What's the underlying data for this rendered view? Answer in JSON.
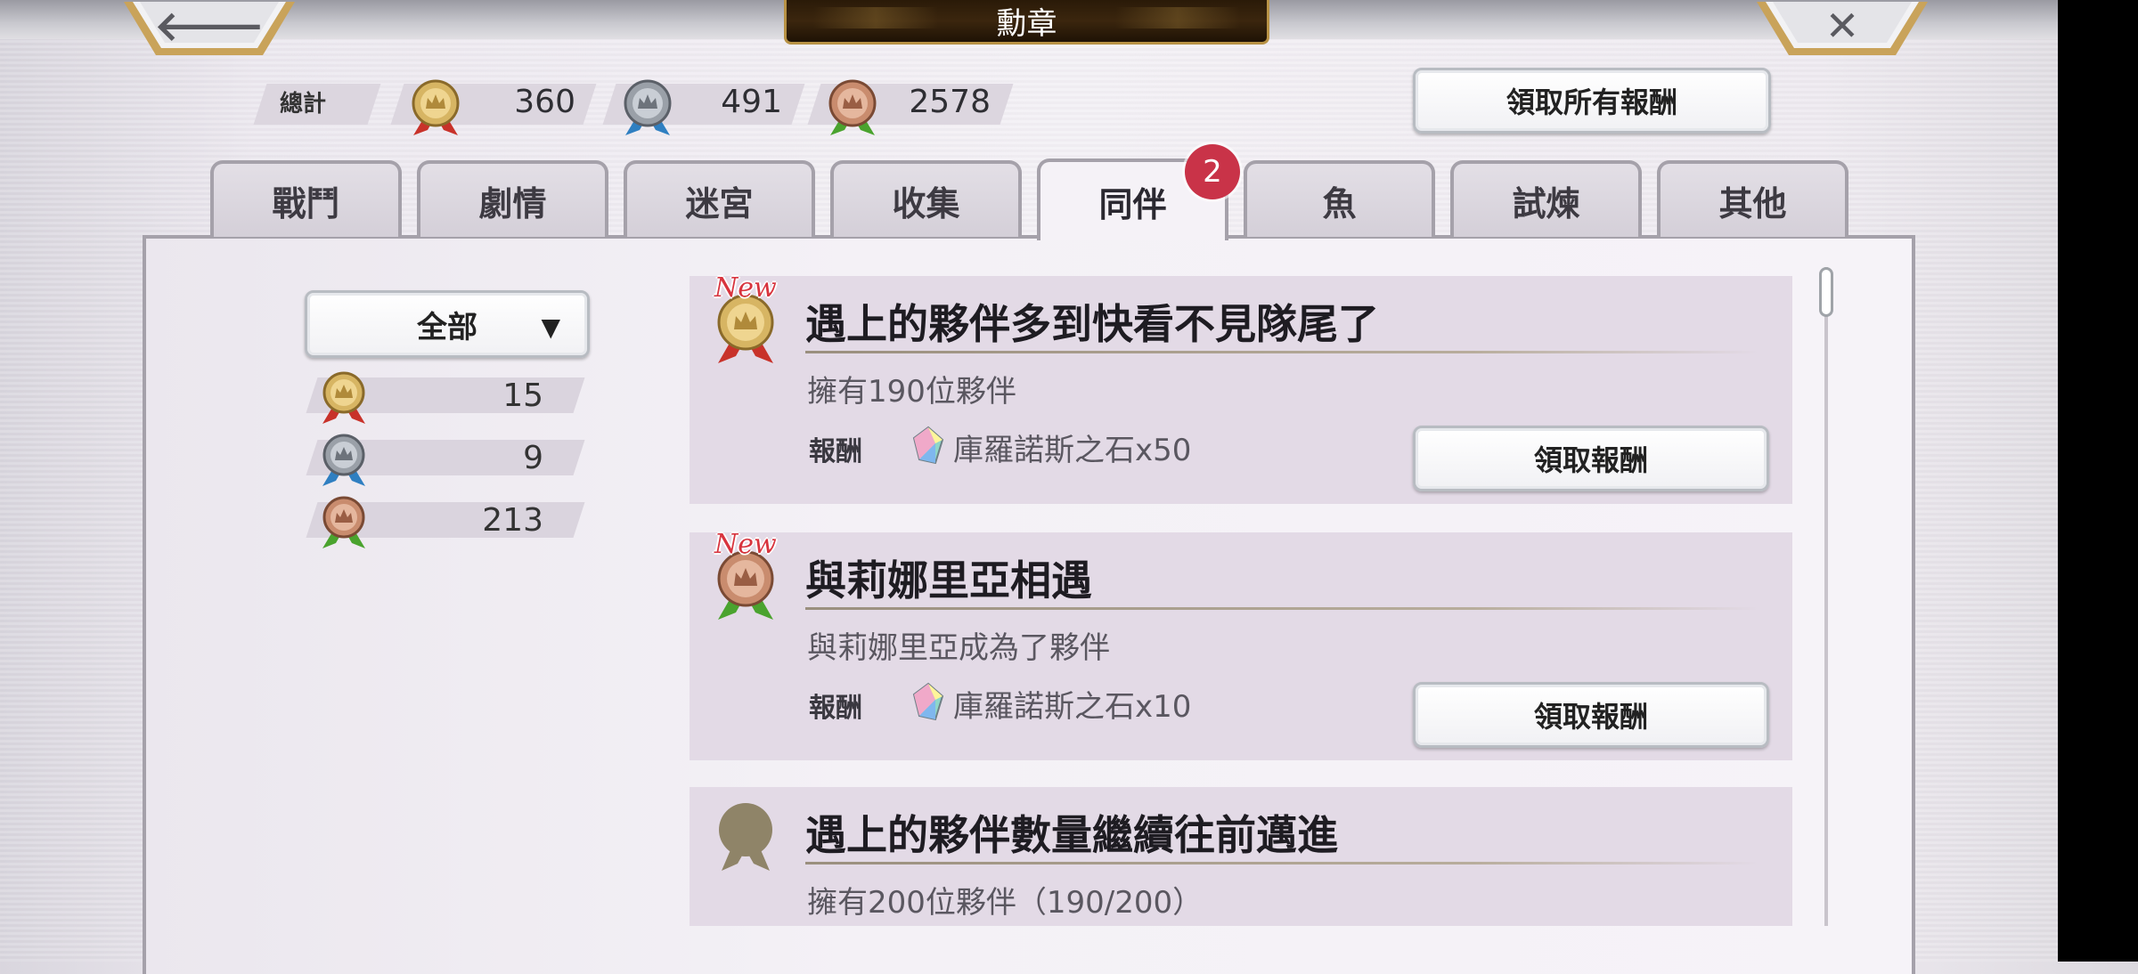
{
  "header": {
    "title": "勳章"
  },
  "totals": {
    "label": "總計",
    "gold": "360",
    "silver": "491",
    "bronze": "2578"
  },
  "claim_all_label": "領取所有報酬",
  "tabs": [
    {
      "label": "戰鬥"
    },
    {
      "label": "劇情"
    },
    {
      "label": "迷宮"
    },
    {
      "label": "收集"
    },
    {
      "label": "同伴",
      "active": true,
      "badge": "2"
    },
    {
      "label": "魚"
    },
    {
      "label": "試煉"
    },
    {
      "label": "其他"
    }
  ],
  "filter": {
    "selected": "全部",
    "counts": {
      "gold": "15",
      "silver": "9",
      "bronze": "213"
    }
  },
  "achievements": [
    {
      "new_tag": "New",
      "medal": "gold",
      "title": "遇上的夥伴多到快看不見隊尾了",
      "description": "擁有190位夥伴",
      "reward_label": "報酬",
      "reward": "庫羅諾斯之石x50",
      "button": "領取報酬"
    },
    {
      "new_tag": "New",
      "medal": "bronze",
      "title": "與莉娜里亞相遇",
      "description": "與莉娜里亞成為了夥伴",
      "reward_label": "報酬",
      "reward": "庫羅諾斯之石x10",
      "button": "領取報酬"
    },
    {
      "medal": "locked",
      "title": "遇上的夥伴數量繼續往前邁進",
      "description": "擁有200位夥伴（190/200）"
    }
  ],
  "colors": {
    "gold_ribbon": "#c8322a",
    "silver_ribbon": "#2f7fc1",
    "bronze_ribbon": "#4aa32e",
    "badge": "#c93348",
    "new_tag": "#d8343e"
  }
}
